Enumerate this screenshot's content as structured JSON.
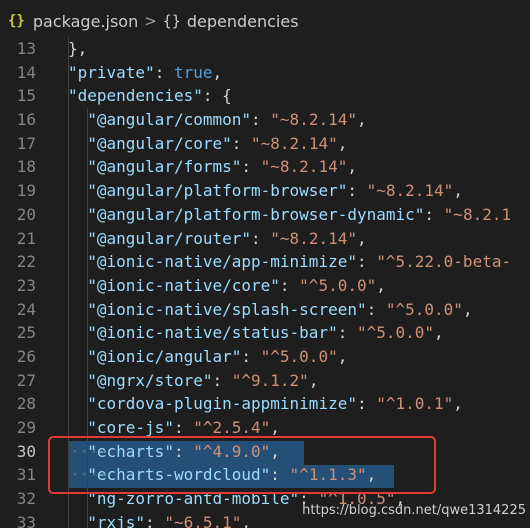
{
  "breadcrumb": {
    "file_icon": "json-braces-icon",
    "file_icon_glyph": "{}",
    "file_name": "package.json",
    "separator": ">",
    "object_icon": "object-braces-icon",
    "object_icon_glyph": "{}",
    "node_name": "dependencies"
  },
  "lines": [
    {
      "num": "13",
      "indent": 2,
      "tokens": [
        {
          "t": "p",
          "v": "},"
        }
      ]
    },
    {
      "num": "14",
      "indent": 2,
      "tokens": [
        {
          "t": "k",
          "v": "\"private\""
        },
        {
          "t": "p",
          "v": ": "
        },
        {
          "t": "b",
          "v": "true"
        },
        {
          "t": "p",
          "v": ","
        }
      ]
    },
    {
      "num": "15",
      "indent": 2,
      "tokens": [
        {
          "t": "k",
          "v": "\"dependencies\""
        },
        {
          "t": "p",
          "v": ": {"
        }
      ]
    },
    {
      "num": "16",
      "indent": 3,
      "tokens": [
        {
          "t": "k",
          "v": "\"@angular/common\""
        },
        {
          "t": "p",
          "v": ": "
        },
        {
          "t": "s",
          "v": "\"~8.2.14\""
        },
        {
          "t": "p",
          "v": ","
        }
      ]
    },
    {
      "num": "17",
      "indent": 3,
      "tokens": [
        {
          "t": "k",
          "v": "\"@angular/core\""
        },
        {
          "t": "p",
          "v": ": "
        },
        {
          "t": "s",
          "v": "\"~8.2.14\""
        },
        {
          "t": "p",
          "v": ","
        }
      ]
    },
    {
      "num": "18",
      "indent": 3,
      "tokens": [
        {
          "t": "k",
          "v": "\"@angular/forms\""
        },
        {
          "t": "p",
          "v": ": "
        },
        {
          "t": "s",
          "v": "\"~8.2.14\""
        },
        {
          "t": "p",
          "v": ","
        }
      ]
    },
    {
      "num": "19",
      "indent": 3,
      "tokens": [
        {
          "t": "k",
          "v": "\"@angular/platform-browser\""
        },
        {
          "t": "p",
          "v": ": "
        },
        {
          "t": "s",
          "v": "\"~8.2.14\""
        },
        {
          "t": "p",
          "v": ","
        }
      ]
    },
    {
      "num": "20",
      "indent": 3,
      "tokens": [
        {
          "t": "k",
          "v": "\"@angular/platform-browser-dynamic\""
        },
        {
          "t": "p",
          "v": ": "
        },
        {
          "t": "s",
          "v": "\"~8.2.1"
        }
      ]
    },
    {
      "num": "21",
      "indent": 3,
      "tokens": [
        {
          "t": "k",
          "v": "\"@angular/router\""
        },
        {
          "t": "p",
          "v": ": "
        },
        {
          "t": "s",
          "v": "\"~8.2.14\""
        },
        {
          "t": "p",
          "v": ","
        }
      ]
    },
    {
      "num": "22",
      "indent": 3,
      "tokens": [
        {
          "t": "k",
          "v": "\"@ionic-native/app-minimize\""
        },
        {
          "t": "p",
          "v": ": "
        },
        {
          "t": "s",
          "v": "\"^5.22.0-beta-"
        }
      ]
    },
    {
      "num": "23",
      "indent": 3,
      "tokens": [
        {
          "t": "k",
          "v": "\"@ionic-native/core\""
        },
        {
          "t": "p",
          "v": ": "
        },
        {
          "t": "s",
          "v": "\"^5.0.0\""
        },
        {
          "t": "p",
          "v": ","
        }
      ]
    },
    {
      "num": "24",
      "indent": 3,
      "tokens": [
        {
          "t": "k",
          "v": "\"@ionic-native/splash-screen\""
        },
        {
          "t": "p",
          "v": ": "
        },
        {
          "t": "s",
          "v": "\"^5.0.0\""
        },
        {
          "t": "p",
          "v": ","
        }
      ]
    },
    {
      "num": "25",
      "indent": 3,
      "tokens": [
        {
          "t": "k",
          "v": "\"@ionic-native/status-bar\""
        },
        {
          "t": "p",
          "v": ": "
        },
        {
          "t": "s",
          "v": "\"^5.0.0\""
        },
        {
          "t": "p",
          "v": ","
        }
      ]
    },
    {
      "num": "26",
      "indent": 3,
      "tokens": [
        {
          "t": "k",
          "v": "\"@ionic/angular\""
        },
        {
          "t": "p",
          "v": ": "
        },
        {
          "t": "s",
          "v": "\"^5.0.0\""
        },
        {
          "t": "p",
          "v": ","
        }
      ]
    },
    {
      "num": "27",
      "indent": 3,
      "tokens": [
        {
          "t": "k",
          "v": "\"@ngrx/store\""
        },
        {
          "t": "p",
          "v": ": "
        },
        {
          "t": "s",
          "v": "\"^9.1.2\""
        },
        {
          "t": "p",
          "v": ","
        }
      ]
    },
    {
      "num": "28",
      "indent": 3,
      "tokens": [
        {
          "t": "k",
          "v": "\"cordova-plugin-appminimize\""
        },
        {
          "t": "p",
          "v": ": "
        },
        {
          "t": "s",
          "v": "\"^1.0.1\""
        },
        {
          "t": "p",
          "v": ","
        }
      ]
    },
    {
      "num": "29",
      "indent": 3,
      "tokens": [
        {
          "t": "k",
          "v": "\"core-js\""
        },
        {
          "t": "p",
          "v": ": "
        },
        {
          "t": "s",
          "v": "\"^2.5.4\""
        },
        {
          "t": "p",
          "v": ","
        }
      ]
    },
    {
      "num": "30",
      "indent": 3,
      "selected": true,
      "active": true,
      "tokens": [
        {
          "t": "k",
          "v": "\"echarts\""
        },
        {
          "t": "p",
          "v": ": "
        },
        {
          "t": "s",
          "v": "\"^4.9.0\""
        },
        {
          "t": "p",
          "v": ","
        }
      ]
    },
    {
      "num": "31",
      "indent": 3,
      "selected": true,
      "tokens": [
        {
          "t": "k",
          "v": "\"echarts-wordcloud\""
        },
        {
          "t": "p",
          "v": ": "
        },
        {
          "t": "s",
          "v": "\"^1.1.3\""
        },
        {
          "t": "p",
          "v": ","
        }
      ]
    },
    {
      "num": "32",
      "indent": 3,
      "tokens": [
        {
          "t": "k",
          "v": "\"ng-zorro-antd-mobile\""
        },
        {
          "t": "p",
          "v": ": "
        },
        {
          "t": "s",
          "v": "\"^1.0.5\""
        },
        {
          "t": "p",
          "v": ","
        }
      ]
    },
    {
      "num": "33",
      "indent": 3,
      "tokens": [
        {
          "t": "k",
          "v": "\"rxjs\""
        },
        {
          "t": "p",
          "v": ": "
        },
        {
          "t": "s",
          "v": "\"~6.5.1\""
        },
        {
          "t": "p",
          "v": ","
        }
      ]
    }
  ],
  "whitespace_glyph": "····",
  "annotation": {
    "color": "#e53935"
  },
  "watermark": "https://blog.csdn.net/qwe1314225",
  "colors": {
    "background": "#1e1e1e",
    "key": "#9cdcfe",
    "string": "#ce9178",
    "boolean": "#569cd6",
    "selection": "#264f78",
    "line_number": "#858585"
  }
}
